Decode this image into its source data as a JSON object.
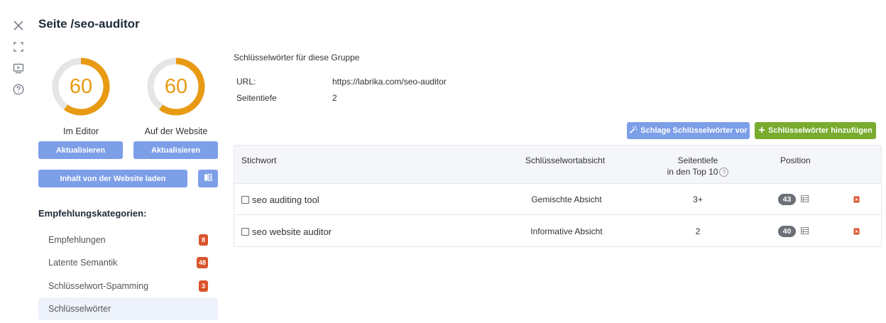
{
  "page": {
    "title": "Seite /seo-auditor"
  },
  "rail": {
    "icons": [
      "close-icon",
      "fullscreen-icon",
      "video-icon",
      "help-icon"
    ]
  },
  "scores": [
    {
      "value": "60",
      "caption": "Im Editor",
      "fraction": 0.6
    },
    {
      "value": "60",
      "caption": "Auf der Website",
      "fraction": 0.6
    }
  ],
  "buttons": {
    "refresh_editor": "Aktualisieren",
    "refresh_website": "Aktualisieren",
    "load_content": "Inhalt von der Website laden",
    "suggest": "Schlage Schlüsselwörter vor",
    "add": "Schlüsselwörter hinzufügen"
  },
  "recommendations": {
    "heading": "Empfehlungskategorien:",
    "items": [
      {
        "label": "Empfehlungen",
        "count": "8"
      },
      {
        "label": "Latente Semantik",
        "count": "48"
      },
      {
        "label": "Schlüsselwort-Spamming",
        "count": "3"
      },
      {
        "label": "Schlüsselwörter",
        "count": ""
      }
    ]
  },
  "group": {
    "title": "Schlüsselwörter für diese Gruppe",
    "url_label": "URL:",
    "url_value": "https://labrika.com/seo-auditor",
    "depth_label": "Seitentiefe",
    "depth_value": "2"
  },
  "table": {
    "headers": {
      "keyword": "Stichwort",
      "intent": "Schlüsselwortabsicht",
      "depth_line1": "Seitentiefe",
      "depth_line2": "in den Top 10",
      "position": "Position"
    },
    "rows": [
      {
        "keyword": "seo auditing tool",
        "intent": "Gemischte Absicht",
        "depth": "3+",
        "position": "43"
      },
      {
        "keyword": "seo website auditor",
        "intent": "Informative Absicht",
        "depth": "2",
        "position": "40"
      }
    ]
  },
  "colors": {
    "accent_blue": "#7d9fe8",
    "accent_green": "#78ab2e",
    "score_orange": "#e89a12",
    "badge_red": "#d9542c"
  }
}
